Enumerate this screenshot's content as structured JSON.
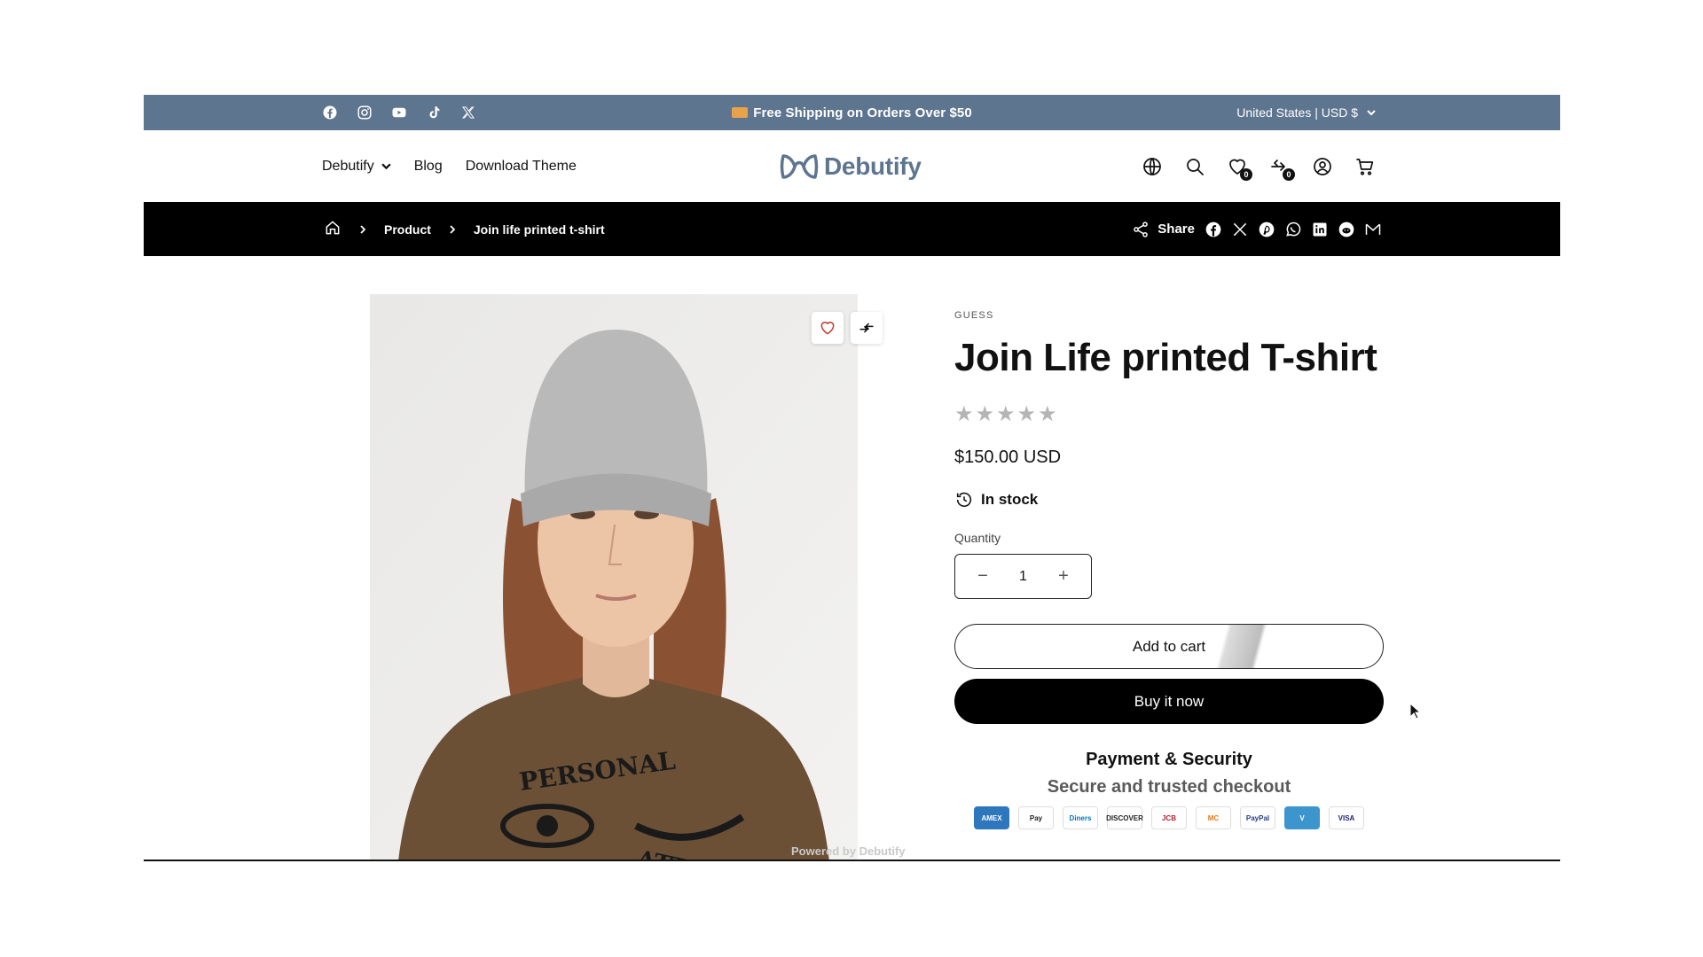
{
  "announcement": {
    "text": "Free Shipping on Orders Over $50",
    "locale": "United States | USD $",
    "social_icons": [
      "facebook-icon",
      "instagram-icon",
      "youtube-icon",
      "tiktok-icon",
      "x-icon"
    ]
  },
  "header": {
    "nav": [
      {
        "label": "Debutify",
        "has_dropdown": true
      },
      {
        "label": "Blog",
        "has_dropdown": false
      },
      {
        "label": "Download Theme",
        "has_dropdown": false
      }
    ],
    "logo_text": "Debutify",
    "wishlist_count": "0",
    "compare_count": "0",
    "icons": [
      "globe-icon",
      "search-icon",
      "wishlist-icon",
      "compare-icon",
      "account-icon",
      "cart-icon"
    ]
  },
  "breadcrumb": {
    "items": [
      "Product",
      "Join life printed t-shirt"
    ],
    "share_label": "Share",
    "share_icons": [
      "facebook-icon",
      "x-icon",
      "pinterest-icon",
      "whatsapp-icon",
      "linkedin-icon",
      "reddit-icon",
      "email-icon"
    ]
  },
  "product": {
    "vendor": "GUESS",
    "title": "Join Life printed T-shirt",
    "rating": 0,
    "rating_max": 5,
    "price": "$150.00 USD",
    "stock": "In stock",
    "quantity_label": "Quantity",
    "quantity": "1",
    "add_to_cart": "Add to cart",
    "buy_now": "Buy it now",
    "powered_by": "Powered by Debutify"
  },
  "payment": {
    "title": "Payment & Security",
    "subtitle": "Secure and trusted checkout",
    "cards": [
      "AMEX",
      "Pay",
      "Diners",
      "DISCOVER",
      "JCB",
      "MC",
      "PayPal",
      "V",
      "VISA"
    ]
  },
  "colors": {
    "announcement_bg": "#5e7590",
    "breadcrumb_bg": "#000000",
    "brand": "#5e7590"
  }
}
